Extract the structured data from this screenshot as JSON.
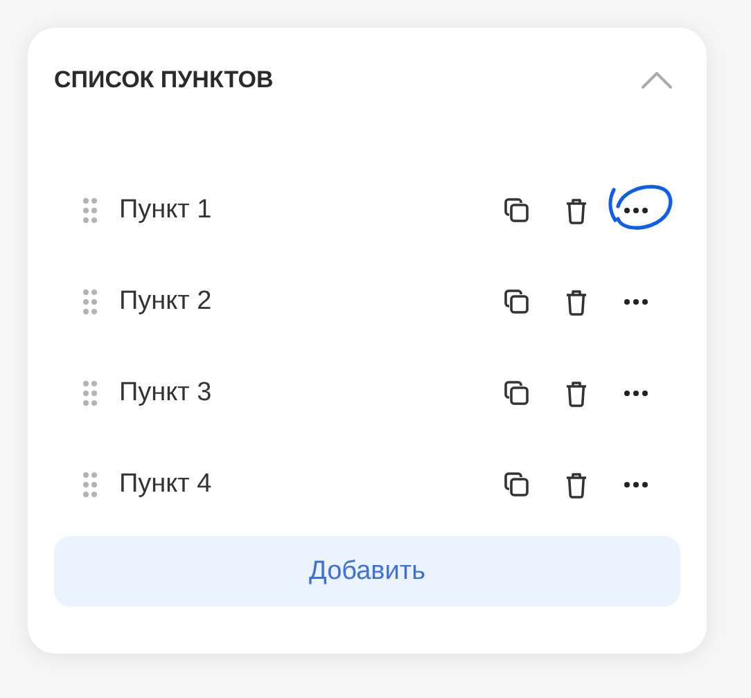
{
  "panel": {
    "title": "СПИСОК ПУНКТОВ",
    "expanded": true
  },
  "items": [
    {
      "label": "Пункт 1",
      "highlighted": true
    },
    {
      "label": "Пункт 2",
      "highlighted": false
    },
    {
      "label": "Пункт 3",
      "highlighted": false
    },
    {
      "label": "Пункт 4",
      "highlighted": false
    }
  ],
  "add_button": "Добавить"
}
